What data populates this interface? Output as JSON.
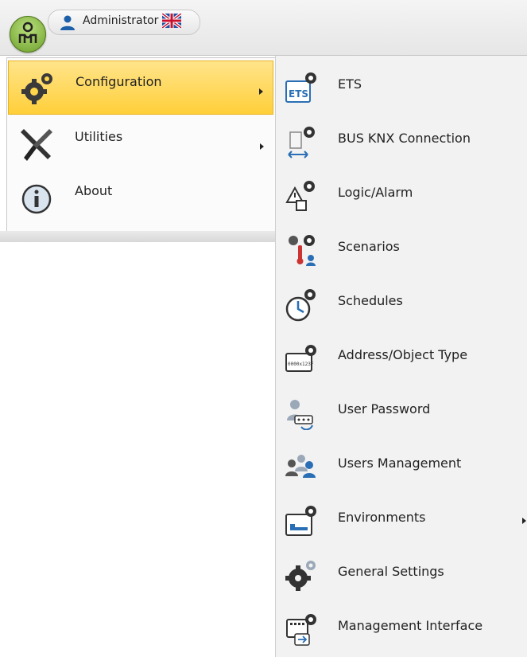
{
  "header": {
    "user_name": "Administrator",
    "user_icon": "user-icon",
    "flag_icon": "uk-flag-icon",
    "app_button_icon": "app-menu-icon"
  },
  "menu": {
    "items": [
      {
        "label": "Configuration",
        "icon": "gears-icon",
        "selected": true,
        "has_submenu": true
      },
      {
        "label": "Utilities",
        "icon": "tools-icon",
        "selected": false,
        "has_submenu": true
      },
      {
        "label": "About",
        "icon": "info-icon",
        "selected": false,
        "has_submenu": false
      }
    ]
  },
  "submenu": {
    "items": [
      {
        "label": "ETS",
        "icon": "ets-icon"
      },
      {
        "label": "BUS KNX Connection",
        "icon": "bus-connection-icon"
      },
      {
        "label": "Logic/Alarm",
        "icon": "logic-alarm-icon"
      },
      {
        "label": "Scenarios",
        "icon": "scenarios-icon"
      },
      {
        "label": "Schedules",
        "icon": "schedules-icon"
      },
      {
        "label": "Address/Object Type",
        "icon": "address-type-icon"
      },
      {
        "label": "User Password",
        "icon": "user-password-icon"
      },
      {
        "label": "Users Management",
        "icon": "users-management-icon"
      },
      {
        "label": "Environments",
        "icon": "environments-icon",
        "has_submenu": true
      },
      {
        "label": "General Settings",
        "icon": "gear-settings-icon"
      },
      {
        "label": "Management Interface",
        "icon": "management-interface-icon"
      }
    ]
  },
  "colors": {
    "selected_bg": "#ffd54a",
    "accent_blue": "#2a6fb5",
    "app_green": "#8cc63f"
  }
}
